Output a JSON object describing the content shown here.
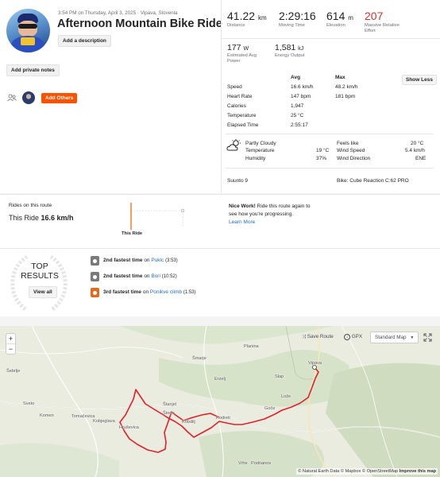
{
  "header": {
    "datetime": "3:54 PM on Thursday, April 3, 2025 · Vipava, Slovenia",
    "title": "Afternoon Mountain Bike Ride",
    "add_description": "Add a description",
    "add_private_notes": "Add private notes",
    "add_others": "Add Others"
  },
  "stats": {
    "distance": {
      "value": "41.22",
      "unit": "km",
      "label": "Distance"
    },
    "moving_time": {
      "value": "2:29:16",
      "label": "Moving Time"
    },
    "elevation": {
      "value": "614",
      "unit": "m",
      "label": "Elevation"
    },
    "relative_effort": {
      "value": "207",
      "label1": "Massive Relative",
      "label2": "Effort"
    },
    "power": {
      "value": "177",
      "unit": "W",
      "label1": "Estimated Avg",
      "label2": "Power"
    },
    "energy": {
      "value": "1,581",
      "unit": "kJ",
      "label": "Energy Output"
    }
  },
  "details": {
    "col_avg": "Avg",
    "col_max": "Max",
    "show_less": "Show Less",
    "rows": [
      {
        "label": "Speed",
        "avg": "16.6 km/h",
        "max": "48.2 km/h"
      },
      {
        "label": "Heart Rate",
        "avg": "147 bpm",
        "max": "181 bpm"
      },
      {
        "label": "Calories",
        "avg": "1,947",
        "max": ""
      },
      {
        "label": "Temperature",
        "avg": "25 °C",
        "max": ""
      },
      {
        "label": "Elapsed Time",
        "avg": "2:55:17",
        "max": ""
      }
    ]
  },
  "weather": {
    "condition": "Partly Cloudy",
    "temperature_label": "Temperature",
    "temperature_value": "19 °C",
    "humidity_label": "Humidity",
    "humidity_value": "37%",
    "feels_like_label": "Feels like",
    "feels_like_value": "20 °C",
    "wind_speed_label": "Wind Speed",
    "wind_speed_value": "5.4 km/h",
    "wind_direction_label": "Wind Direction",
    "wind_direction_value": "ENE"
  },
  "device": "Suunto 9",
  "bike": "Bike: Cube Reaction C:62 PRO",
  "route_compare": {
    "title": "Rides on this route",
    "this_ride_label": "This Ride",
    "this_ride_value": "16.6 km/h",
    "chart_label": "This Ride",
    "nice_work": "Nice Work!",
    "message1": "Ride this route again to",
    "message2": "see how you're progressing.",
    "learn_more": "Learn More"
  },
  "results": {
    "badge_line1": "TOP",
    "badge_line2": "RESULTS",
    "view_all": "View all",
    "items": [
      {
        "rank": "2nd fastest time",
        "on": "on",
        "segment": "Puklc",
        "time": "(3:53)",
        "color": "#7a7a7a"
      },
      {
        "rank": "2nd fastest time",
        "on": "on",
        "segment": "Bori",
        "time": "(10:52)",
        "color": "#7a7a7a"
      },
      {
        "rank": "3rd fastest time",
        "on": "on",
        "segment": "Ponikve climb",
        "time": "(1:53)",
        "color": "#e06b20"
      }
    ]
  },
  "map": {
    "save_route": "Save Route",
    "gpx": "GPX",
    "map_style": "Standard Map",
    "zoom_in": "+",
    "zoom_out": "−",
    "attribution": "© Natural Earth Data © Mapbox © OpenStreetMap",
    "improve": "Improve this map",
    "places": [
      {
        "name": "Planina"
      },
      {
        "name": "Šmarje"
      },
      {
        "name": "Erzelj"
      },
      {
        "name": "Slap"
      },
      {
        "name": "Vipava"
      },
      {
        "name": "Štanjel"
      },
      {
        "name": "Štorje"
      },
      {
        "name": "Kobdilj"
      },
      {
        "name": "Kodreti"
      },
      {
        "name": "Goče"
      },
      {
        "name": "Lože"
      },
      {
        "name": "Šebrlje"
      },
      {
        "name": "Sveto"
      },
      {
        "name": "Komen"
      },
      {
        "name": "Tomačevica"
      },
      {
        "name": "Kobjeglava"
      },
      {
        "name": "Hruševica"
      },
      {
        "name": "Podnanos"
      },
      {
        "name": "Vrhe"
      }
    ]
  },
  "colors": {
    "brand_orange": "#fc5200",
    "effort_red": "#d0342c",
    "route_red": "#e2202a",
    "link_blue": "#1c6dd0"
  }
}
